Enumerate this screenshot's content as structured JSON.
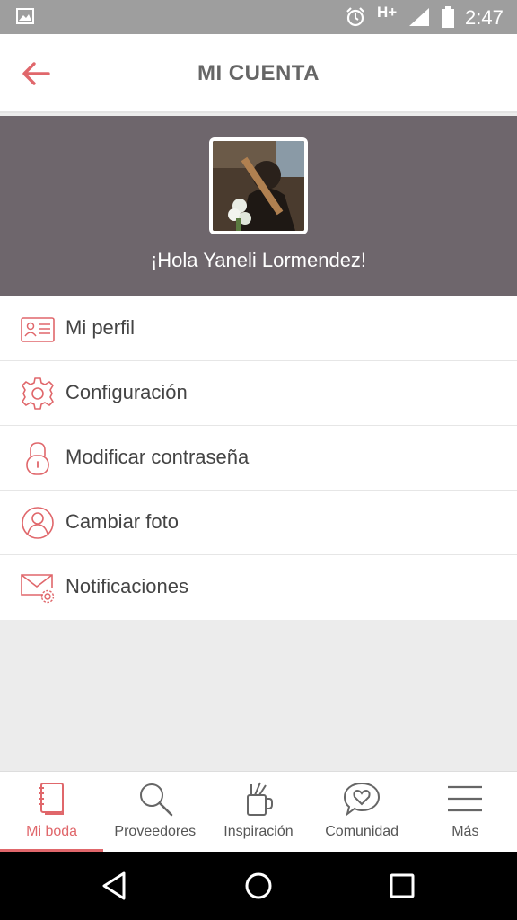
{
  "status_bar": {
    "network": "H+",
    "time": "2:47"
  },
  "header": {
    "title": "MI CUENTA"
  },
  "profile": {
    "greeting": "¡Hola Yaneli Lormendez!"
  },
  "menu": {
    "items": [
      {
        "label": "Mi perfil",
        "icon": "id-card-icon"
      },
      {
        "label": "Configuración",
        "icon": "gear-icon"
      },
      {
        "label": "Modificar contraseña",
        "icon": "lock-icon"
      },
      {
        "label": "Cambiar foto",
        "icon": "user-photo-icon"
      },
      {
        "label": "Notificaciones",
        "icon": "mail-settings-icon"
      }
    ]
  },
  "bottom_nav": {
    "tabs": [
      {
        "label": "Mi boda",
        "icon": "notebook-icon",
        "active": true
      },
      {
        "label": "Proveedores",
        "icon": "search-icon",
        "active": false
      },
      {
        "label": "Inspiración",
        "icon": "pencil-cup-icon",
        "active": false
      },
      {
        "label": "Comunidad",
        "icon": "chat-heart-icon",
        "active": false
      },
      {
        "label": "Más",
        "icon": "menu-icon",
        "active": false
      }
    ]
  },
  "colors": {
    "accent": "#e0676b",
    "banner": "#6e666c",
    "status_bar": "#9e9e9e"
  }
}
